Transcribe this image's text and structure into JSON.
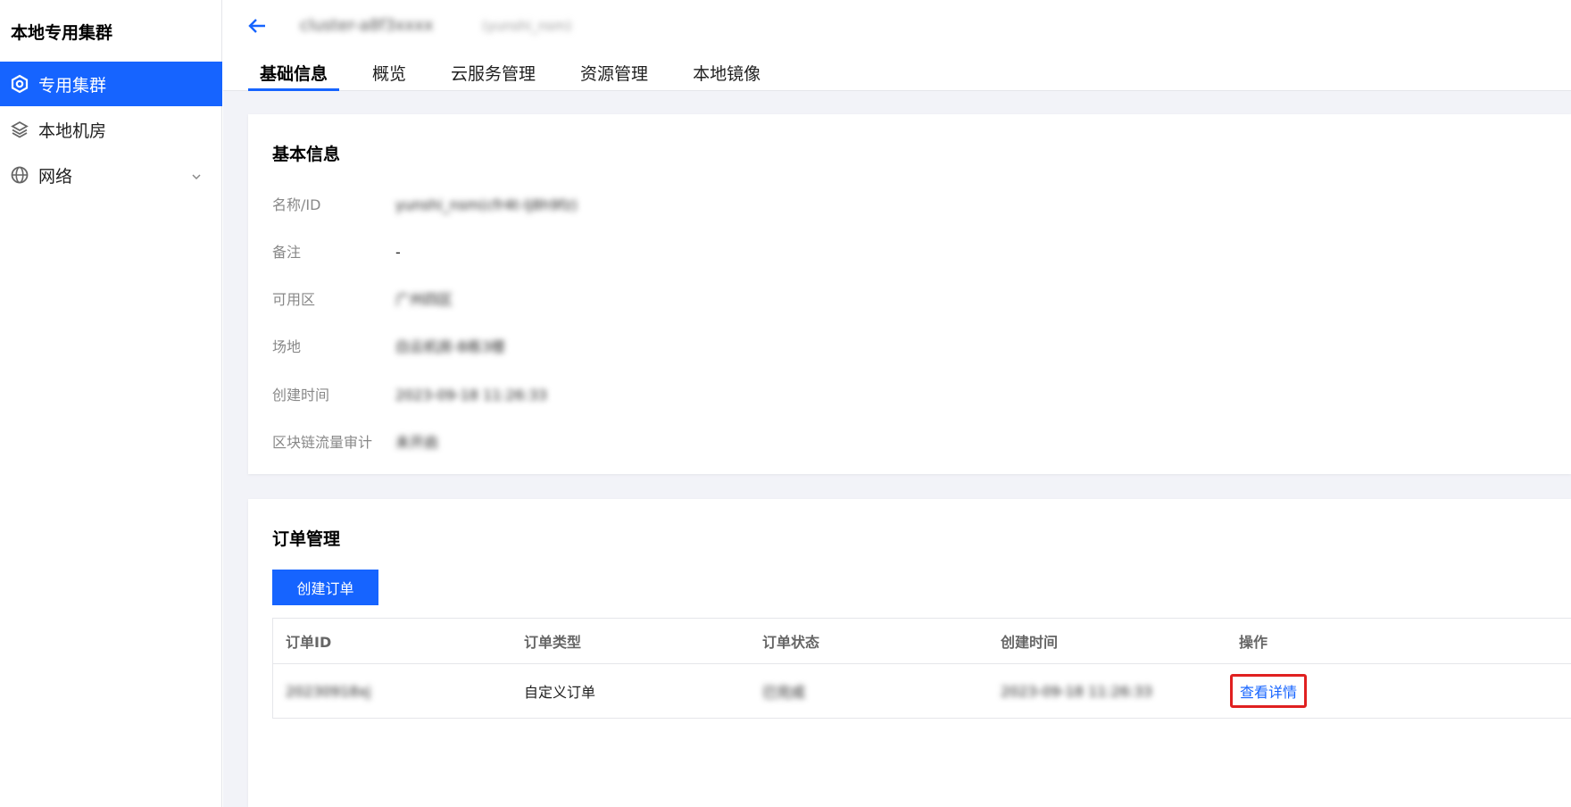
{
  "sidebar": {
    "title": "本地专用集群",
    "items": [
      {
        "label": "专用集群",
        "icon": "cluster-icon",
        "active": true
      },
      {
        "label": "本地机房",
        "icon": "layers-icon",
        "active": false
      },
      {
        "label": "网络",
        "icon": "globe-icon",
        "active": false
      }
    ]
  },
  "header": {
    "name": "cluster-a8f3xxxx",
    "sub": "(yunshi_nsm)"
  },
  "tabs": [
    {
      "label": "基础信息",
      "active": true
    },
    {
      "label": "概览"
    },
    {
      "label": "云服务管理"
    },
    {
      "label": "资源管理"
    },
    {
      "label": "本地镜像"
    }
  ],
  "basic_info": {
    "title": "基本信息",
    "rows": [
      {
        "label": "名称/ID",
        "value": "yunshi_nsm(cfr4t-lj8h9fz)"
      },
      {
        "label": "备注",
        "value": "-"
      },
      {
        "label": "可用区",
        "value": "广州四区"
      },
      {
        "label": "场地",
        "value": "白云机房-B栋3楼"
      },
      {
        "label": "创建时间",
        "value": "2023-09-18 11:26:33"
      },
      {
        "label": "区块链流量审计",
        "value": "未开启"
      }
    ]
  },
  "orders": {
    "title": "订单管理",
    "create_label": "创建订单",
    "columns": [
      "订单ID",
      "订单类型",
      "订单状态",
      "创建时间",
      "操作"
    ],
    "rows": [
      {
        "id": "20230918xj",
        "type": "自定义订单",
        "status": "已完成",
        "created": "2023-09-18 11:26:33",
        "action": "查看详情"
      }
    ]
  },
  "colors": {
    "accent": "#1664ff",
    "highlight": "#e02020"
  }
}
